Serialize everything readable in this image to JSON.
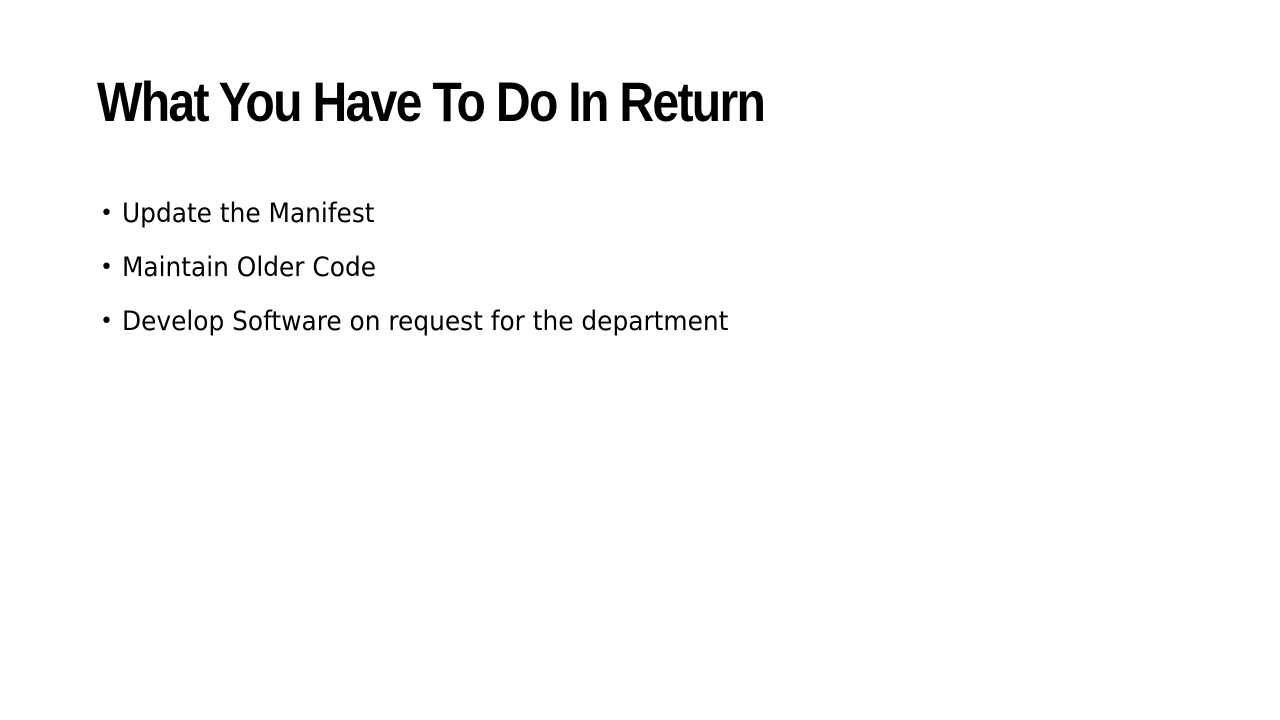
{
  "slide": {
    "title": "What You Have To Do In Return",
    "bullets": [
      {
        "marker": "•",
        "text": "Update the Manifest"
      },
      {
        "marker": "•",
        "text": "Maintain Older Code"
      },
      {
        "marker": "•",
        "text": "Develop Software on request for the department"
      }
    ]
  }
}
